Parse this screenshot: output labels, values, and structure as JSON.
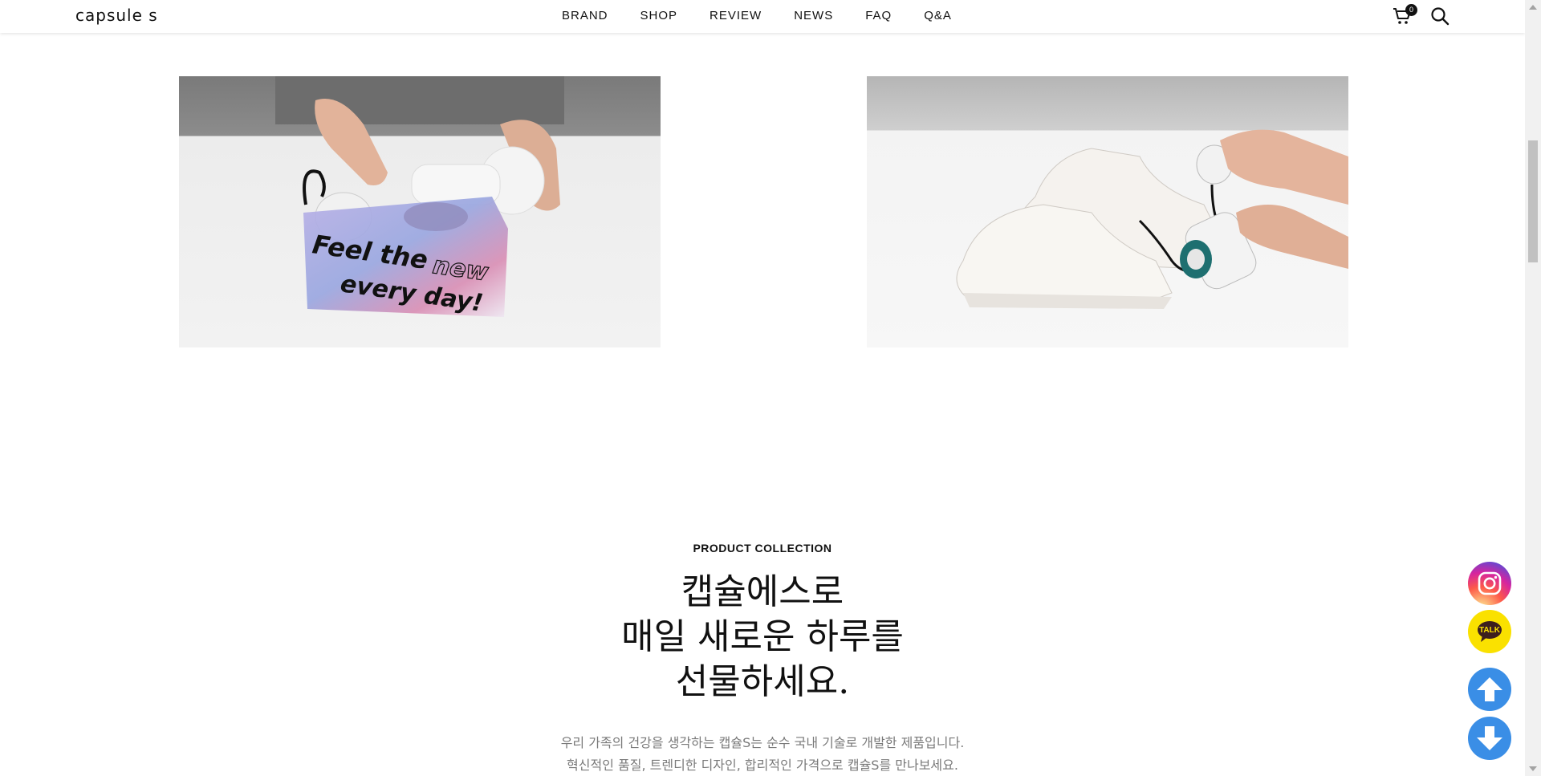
{
  "header": {
    "logo": "capsule s",
    "nav": [
      {
        "label": "BRAND"
      },
      {
        "label": "SHOP"
      },
      {
        "label": "REVIEW"
      },
      {
        "label": "NEWS"
      },
      {
        "label": "FAQ"
      },
      {
        "label": "Q&A"
      }
    ],
    "cart_count": "0",
    "cart_icon": "cart-icon",
    "search_icon": "search-icon"
  },
  "photos": [
    {
      "name": "box-photo",
      "caption_lines": [
        "Feel the",
        "new",
        "every day!"
      ]
    },
    {
      "name": "sneaker-photo"
    }
  ],
  "collection": {
    "eyebrow": "PRODUCT COLLECTION",
    "headline": [
      "캡슐에스로",
      "매일 새로운 하루를",
      "선물하세요."
    ],
    "description": [
      "우리 가족의 건강을 생각하는 캡슐S는 순수 국내 기술로 개발한 제품입니다.",
      "혁신적인 품질, 트렌디한 디자인, 합리적인 가격으로 캡슐S를 만나보세요."
    ]
  },
  "floating": {
    "instagram_icon": "instagram-icon",
    "talk_label": "TALK",
    "up_icon": "arrow-up-icon",
    "down_icon": "arrow-down-icon"
  },
  "colors": {
    "accent_blue": "#3a8ee6",
    "kakao_yellow": "#fae100",
    "text_gray": "#7a7a7a"
  }
}
